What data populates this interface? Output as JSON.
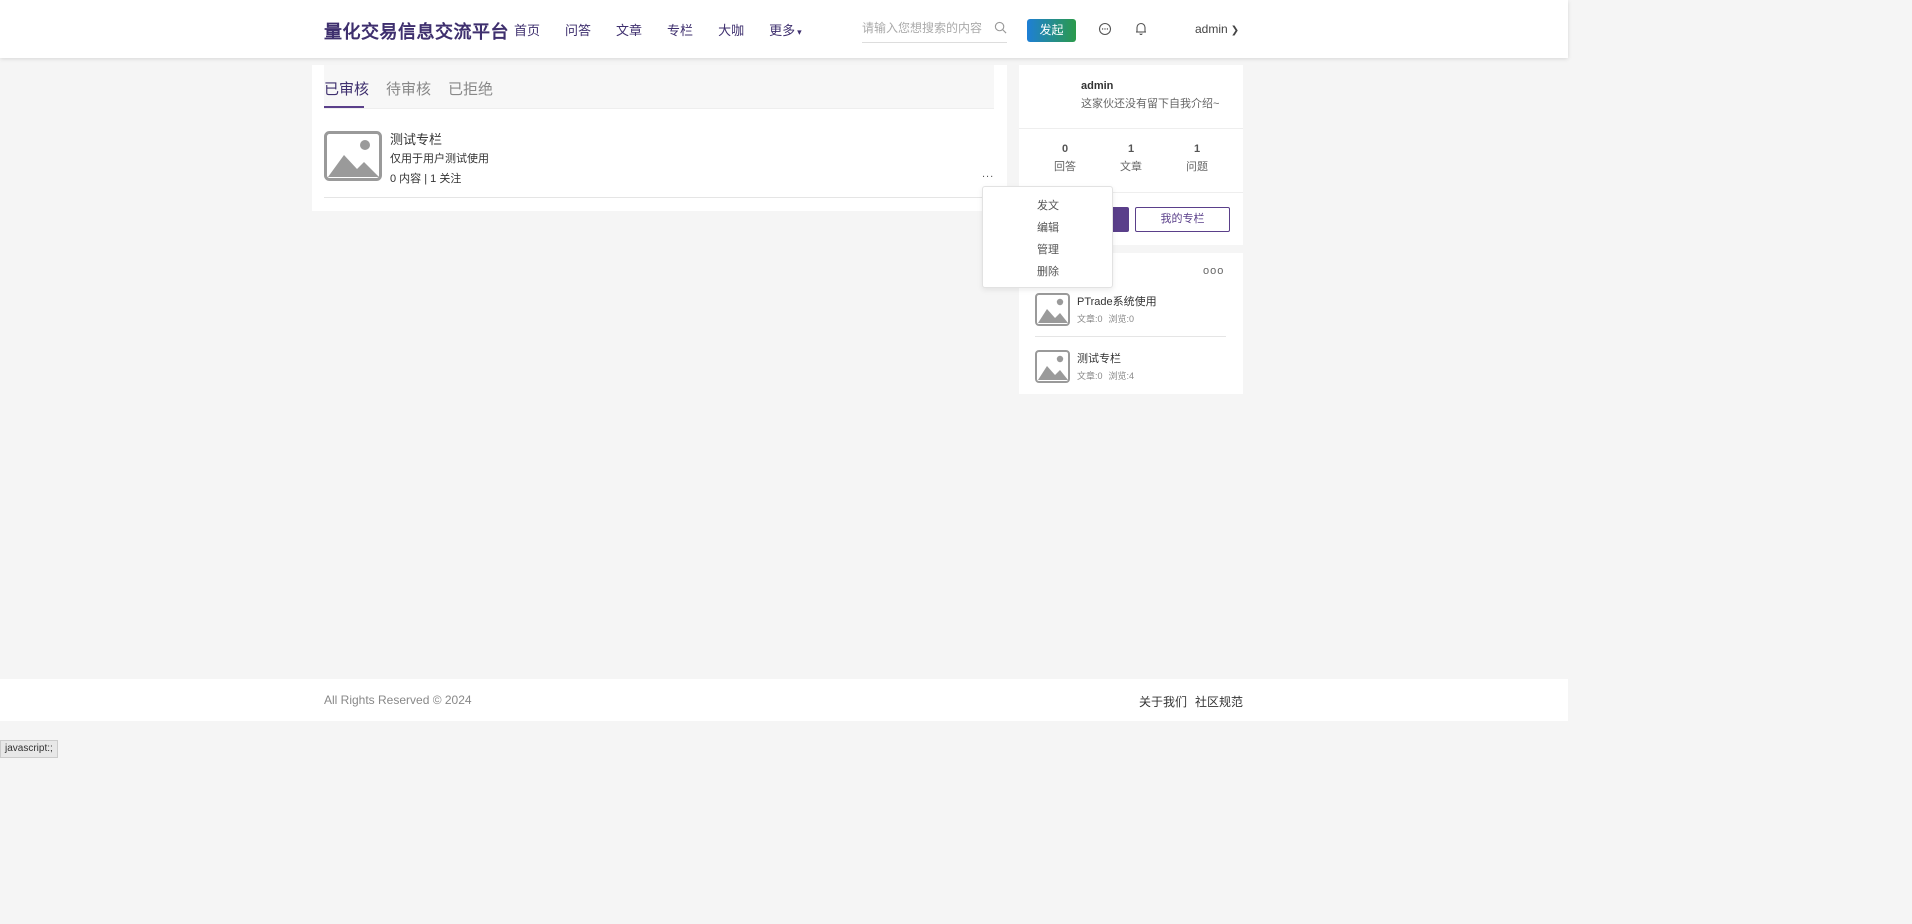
{
  "header": {
    "brand": "量化交易信息交流平台",
    "nav": [
      "首页",
      "问答",
      "文章",
      "专栏",
      "大咖",
      "更多"
    ],
    "search_placeholder": "请输入您想搜索的内容",
    "launch_label": "发起",
    "user": "admin"
  },
  "tabs": [
    "已审核",
    "待审核",
    "已拒绝"
  ],
  "column_item": {
    "title": "测试专栏",
    "desc": "仅用于用户测试使用",
    "stats": "0 内容 | 1 关注",
    "more": "..."
  },
  "dropdown": [
    "发文",
    "编辑",
    "管理",
    "删除"
  ],
  "profile": {
    "name": "admin",
    "bio": "这家伙还没有留下自我介绍~",
    "stats": [
      {
        "num": "0",
        "label": "回答"
      },
      {
        "num": "1",
        "label": "文章"
      },
      {
        "num": "1",
        "label": "问题"
      }
    ],
    "my_columns_label": "我的专栏"
  },
  "sidebar_columns": {
    "more": "ooo",
    "items": [
      {
        "title": "PTrade系统使用",
        "articles": "文章:0",
        "views": "浏览:0"
      },
      {
        "title": "测试专栏",
        "articles": "文章:0",
        "views": "浏览:4"
      }
    ]
  },
  "footer": {
    "copyright": "All Rights Reserved © 2024",
    "links": [
      "关于我们",
      "社区规范"
    ]
  },
  "status_bar": "javascript:;",
  "colors": {
    "brand_purple": "#3e2f6e",
    "accent_purple": "#5a3f8a",
    "launch_gradient_start": "#1e7fd6",
    "launch_gradient_end": "#2b9a4b"
  }
}
